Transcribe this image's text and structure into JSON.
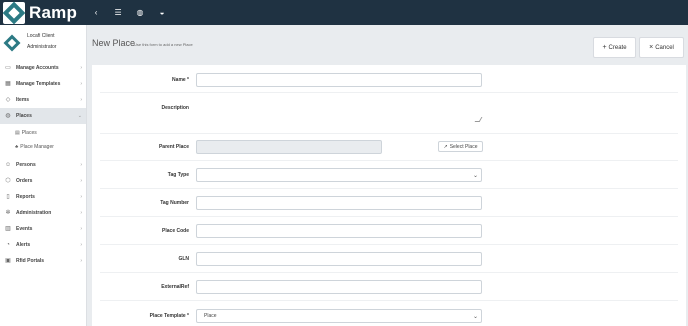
{
  "app": {
    "name": "Ramp"
  },
  "topbar": {
    "icons": [
      "chevron-left-icon",
      "menu-icon",
      "globe-icon",
      "dashboard-icon"
    ]
  },
  "user": {
    "name": "Locafi Client",
    "role": "Administrator"
  },
  "sidebar": {
    "items": [
      {
        "label": "Manage Accounts",
        "icon": "briefcase-icon"
      },
      {
        "label": "Manage Templates",
        "icon": "template-icon"
      },
      {
        "label": "Items",
        "icon": "tag-icon"
      },
      {
        "label": "Places",
        "icon": "globe-icon",
        "active": true,
        "children": [
          {
            "label": "Places",
            "icon": "list-icon"
          },
          {
            "label": "Place Manager",
            "icon": "sitemap-icon"
          }
        ]
      },
      {
        "label": "Persons",
        "icon": "person-icon"
      },
      {
        "label": "Orders",
        "icon": "box-icon"
      },
      {
        "label": "Reports",
        "icon": "document-icon"
      },
      {
        "label": "Administration",
        "icon": "gear-icon"
      },
      {
        "label": "Events",
        "icon": "chart-icon"
      },
      {
        "label": "Alerts",
        "icon": "bell-icon"
      },
      {
        "label": "Rfid Portals",
        "icon": "portal-icon"
      }
    ]
  },
  "page": {
    "title": "New Place",
    "subtitle": "Use this form to add a new Place",
    "create_label": "Create",
    "cancel_label": "Cancel"
  },
  "form": {
    "name_label": "Name *",
    "description_label": "Description",
    "parent_place_label": "Parent Place",
    "select_place_label": "Select Place",
    "tag_type_label": "Tag Type",
    "tag_number_label": "Tag Number",
    "place_code_label": "Place Code",
    "gln_label": "GLN",
    "external_ref_label": "ExternalRef",
    "place_template_label": "Place Template *",
    "place_template_value": "Place"
  }
}
